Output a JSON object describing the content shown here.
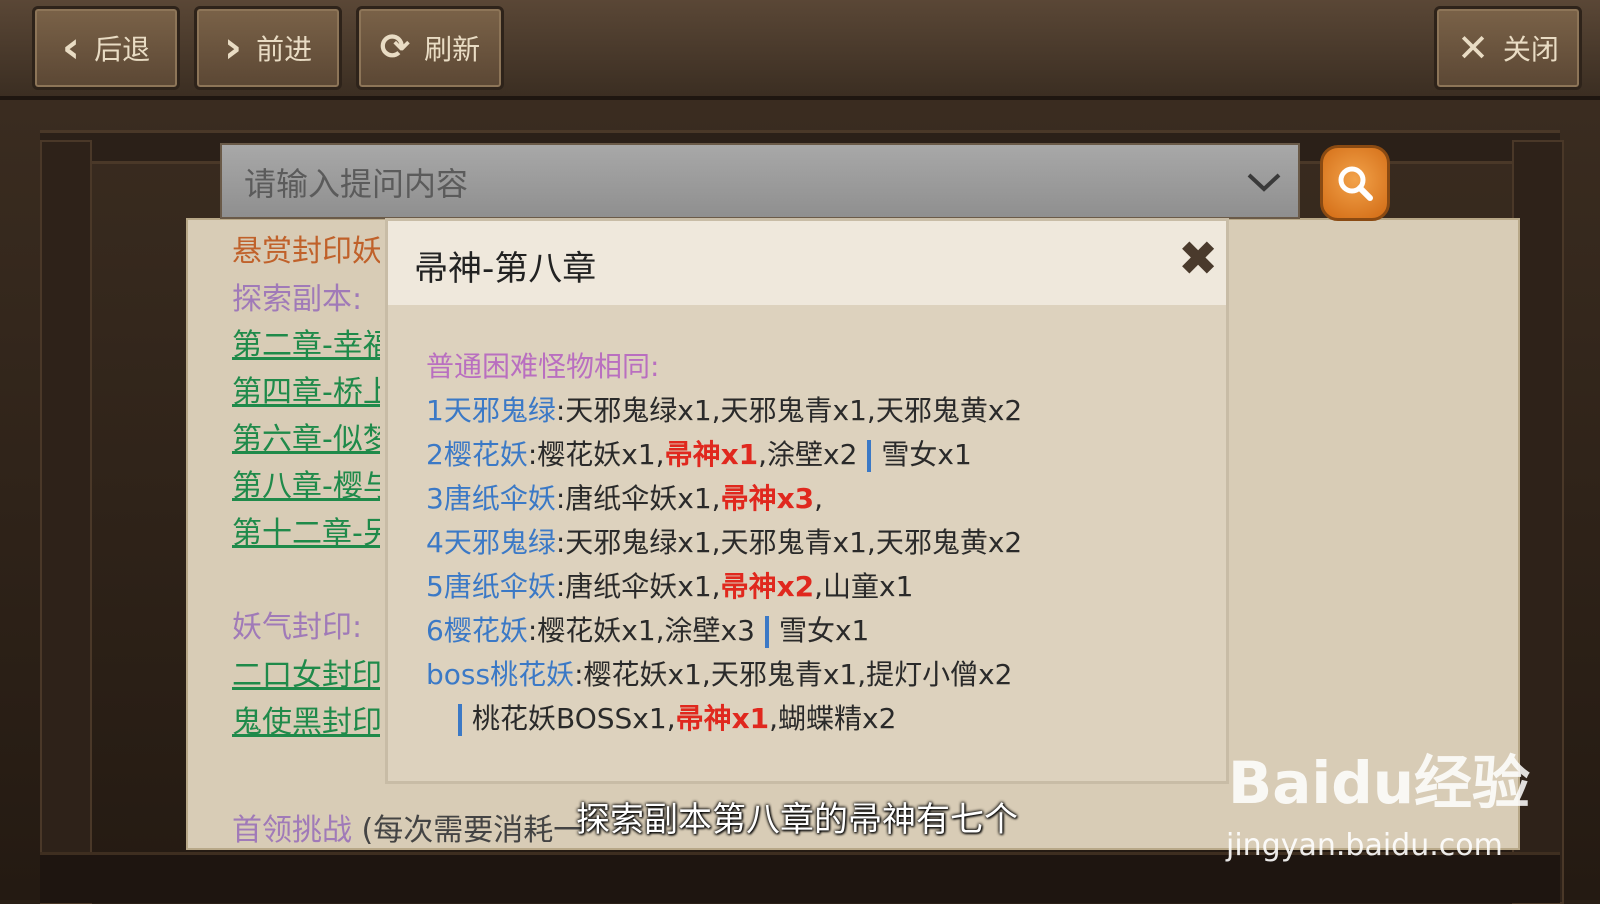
{
  "toolbar": {
    "back_label": "后退",
    "forward_label": "前进",
    "refresh_label": "刷新",
    "close_label": "关闭"
  },
  "search": {
    "placeholder": "请输入提问内容"
  },
  "panel": {
    "bounty_heading": "悬赏封印妖怪",
    "explore_heading": "探索副本:",
    "explore_links": [
      "第二章-幸福",
      "第四章-桥上",
      "第六章-似梦",
      "第八章-樱与",
      "第十二章-另"
    ],
    "seal_heading": "妖气封印:",
    "seal_links": [
      "二口女封印(",
      "鬼使黑封印("
    ],
    "boss_challenge_label": "首领挑战",
    "boss_challenge_note": "(每次需要消耗一"
  },
  "modal": {
    "title": "帚神-第八章",
    "intro": "普通困难怪物相同:",
    "rows": [
      {
        "label": "1天邪鬼绿",
        "pre": "天邪鬼绿x1,天邪鬼青x1,天邪鬼黄x2",
        "hl": "",
        "post": "",
        "after_sep": ""
      },
      {
        "label": "2樱花妖",
        "pre": "樱花妖x1,",
        "hl": "帚神x1",
        "post": ",涂壁x2",
        "after_sep": "雪女x1"
      },
      {
        "label": "3唐纸伞妖",
        "pre": "唐纸伞妖x1,",
        "hl": "帚神x3",
        "post": ",",
        "after_sep": ""
      },
      {
        "label": "4天邪鬼绿",
        "pre": "天邪鬼绿x1,天邪鬼青x1,天邪鬼黄x2",
        "hl": "",
        "post": "",
        "after_sep": ""
      },
      {
        "label": "5唐纸伞妖",
        "pre": "唐纸伞妖x1,",
        "hl": "帚神x2",
        "post": ",山童x1",
        "after_sep": ""
      },
      {
        "label": "6樱花妖",
        "pre": "樱花妖x1,涂壁x3",
        "hl": "",
        "post": "",
        "after_sep": "雪女x1"
      },
      {
        "label": "boss桃花妖",
        "pre": "樱花妖x1,天邪鬼青x1,提灯小僧x2",
        "hl": "",
        "post": "",
        "after_sep": ""
      }
    ],
    "boss_line2": {
      "pre": "桃花妖BOSSx1,",
      "hl": "帚神x1",
      "post": ",蝴蝶精x2"
    }
  },
  "subtitle": "探索副本第八章的帚神有七个",
  "watermark": {
    "logo": "Baidu经验",
    "url": "jingyan.baidu.com"
  },
  "colors": {
    "highlight": "#e0281e",
    "label_blue": "#3b79c6",
    "link_green": "#1f8a4a",
    "search_button": "#e07e22"
  }
}
